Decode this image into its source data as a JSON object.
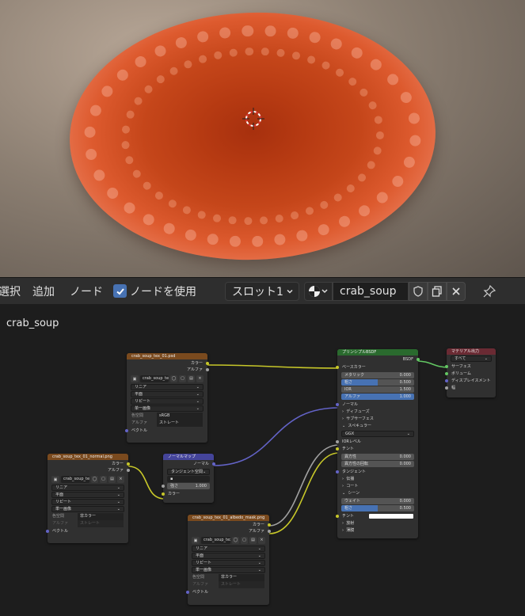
{
  "toolbar": {
    "menu_select": "選択",
    "menu_add": "追加",
    "menu_node": "ノード",
    "use_nodes_label": "ノードを使用",
    "slot": "スロット1",
    "material_name": "crab_soup"
  },
  "editor": {
    "material_label": "crab_soup"
  },
  "nodes": {
    "tex01": {
      "title": "crab_soup_tex_01.psd",
      "out_color": "カラー",
      "out_alpha": "アルファ",
      "image": "crab_soup_tex_...",
      "interp": "リニア",
      "proj": "平面",
      "ext": "リピート",
      "src": "单一画像",
      "colorspace_k": "色空間",
      "colorspace_v": "sRGB",
      "alpha_k": "アルファ",
      "alpha_v": "ストレート",
      "in_vector": "ベクトル"
    },
    "normal": {
      "title": "crab_soup_tex_01_normal.png",
      "out_color": "カラー",
      "out_alpha": "アルファ",
      "image": "crab_soup_tex_...",
      "interp": "リニア",
      "proj": "平面",
      "ext": "リピート",
      "src": "単一画像",
      "colorspace_k": "色空間",
      "colorspace_v": "非カラー",
      "alpha_k": "アルファ",
      "alpha_v": "ストレート",
      "in_vector": "ベクトル"
    },
    "normalmap": {
      "title": "ノーマルマップ",
      "out_normal": "ノーマル",
      "space": "タンジェント空間",
      "strength_k": "強さ",
      "strength_v": "1.000",
      "in_color": "カラー"
    },
    "albedo": {
      "title": "crab_soup_tex_01_albedo_mask.png",
      "out_color": "カラー",
      "out_alpha": "アルファ",
      "image": "crab_soup_tex_...",
      "interp": "リニア",
      "proj": "平面",
      "ext": "リピート",
      "src": "単一画像",
      "colorspace_k": "色空間",
      "colorspace_v": "非カラー",
      "alpha_k": "アルファ",
      "alpha_v": "ストレート",
      "in_vector": "ベクトル"
    },
    "bsdf": {
      "title": "プリンシプルBSDF",
      "out_bsdf": "BSDF",
      "base_color": "ベースカラー",
      "metallic_k": "メタリック",
      "metallic_v": "0.000",
      "rough_k": "粗さ",
      "rough_v": "0.500",
      "ior_k": "IOR",
      "ior_v": "1.500",
      "alpha_k": "アルファ",
      "alpha_v": "1.000",
      "normal": "ノーマル",
      "diffuse": "ディフューズ",
      "subsurface": "サブサーフェス",
      "specular": "スペキュラー",
      "distribution": "GGX",
      "ior_level": "IORレベル",
      "tint": "チント",
      "aniso_k": "異方性",
      "aniso_v": "0.000",
      "aniso_rot_k": "異方性の回転",
      "aniso_rot_v": "0.000",
      "tangent": "タンジェント",
      "transmission": "伝播",
      "coat": "コート",
      "sheen": "シーン",
      "weight_k": "ウェイト",
      "weight_v": "0.000",
      "rough2_k": "粗さ",
      "rough2_v": "0.500",
      "tint2": "チント",
      "emission": "放射",
      "thinfilm": "薄膜"
    },
    "output": {
      "title": "マテリアル出力",
      "target": "すべて",
      "surface": "サーフェス",
      "volume": "ボリューム",
      "displacement": "ディスプレイスメント",
      "thickness": "幅"
    }
  }
}
